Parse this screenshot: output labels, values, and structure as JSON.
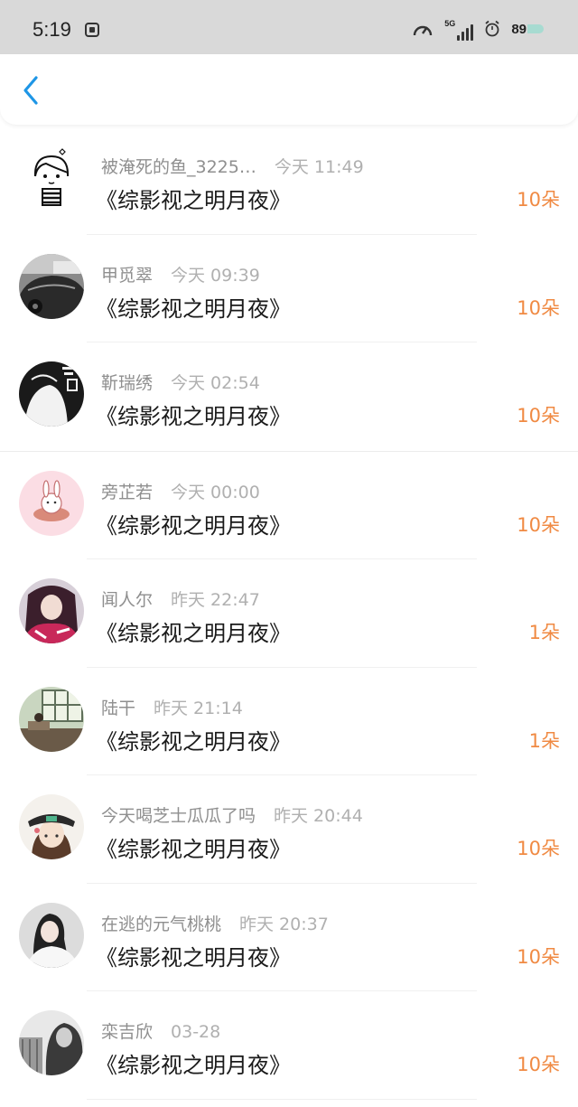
{
  "status_bar": {
    "time": "5:19",
    "network": "5G",
    "battery": "89"
  },
  "colors": {
    "accent_blue": "#1e96e6",
    "amount_orange": "#f08a43"
  },
  "icons": {
    "back": "chevron-left-icon",
    "speed": "speedometer-icon",
    "alarm": "alarm-icon"
  },
  "list": [
    {
      "name": "被淹死的鱼_3225…",
      "time": "今天 11:49",
      "title": "《综影视之明月夜》",
      "amount": "10朵"
    },
    {
      "name": "甲觅翠",
      "time": "今天 09:39",
      "title": "《综影视之明月夜》",
      "amount": "10朵"
    },
    {
      "name": "靳瑞绣",
      "time": "今天 02:54",
      "title": "《综影视之明月夜》",
      "amount": "10朵"
    },
    {
      "name": "旁芷若",
      "time": "今天 00:00",
      "title": "《综影视之明月夜》",
      "amount": "10朵"
    },
    {
      "name": "闻人尔",
      "time": "昨天 22:47",
      "title": "《综影视之明月夜》",
      "amount": "1朵"
    },
    {
      "name": "陆干",
      "time": "昨天 21:14",
      "title": "《综影视之明月夜》",
      "amount": "1朵"
    },
    {
      "name": "今天喝芝士瓜瓜了吗",
      "time": "昨天 20:44",
      "title": "《综影视之明月夜》",
      "amount": "10朵"
    },
    {
      "name": "在逃的元气桃桃",
      "time": "昨天 20:37",
      "title": "《综影视之明月夜》",
      "amount": "10朵"
    },
    {
      "name": "栾吉欣",
      "time": "03-28",
      "title": "《综影视之明月夜》",
      "amount": "10朵"
    }
  ]
}
